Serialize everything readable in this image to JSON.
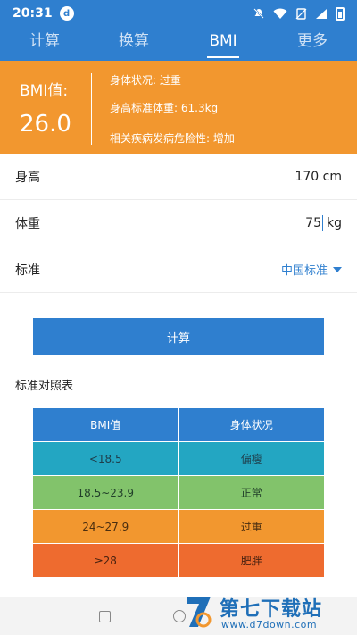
{
  "status_bar": {
    "time": "20:31",
    "app_mark": "d",
    "icons": [
      "mute-icon",
      "wifi-icon",
      "no-sim-icon",
      "signal-icon",
      "battery-icon"
    ]
  },
  "tabs": [
    {
      "label": "计算",
      "active": false
    },
    {
      "label": "换算",
      "active": false
    },
    {
      "label": "BMI",
      "active": true
    },
    {
      "label": "更多",
      "active": false
    }
  ],
  "result": {
    "bmi_label": "BMI值:",
    "bmi_value": "26.0",
    "status": "身体状况: 过重",
    "standard_weight": "身高标准体重: 61.3kg",
    "risk": "相关疾病发病危险性: 增加"
  },
  "inputs": {
    "height_label": "身高",
    "height_value": "170 cm",
    "weight_label": "体重",
    "weight_value": "75",
    "weight_unit": "kg",
    "standard_label": "标准",
    "standard_value": "中国标准"
  },
  "calculate_label": "计算",
  "reference": {
    "title": "标准对照表",
    "headers": [
      "BMI值",
      "身体状况"
    ],
    "rows": [
      [
        "<18.5",
        "偏瘦"
      ],
      [
        "18.5~23.9",
        "正常"
      ],
      [
        "24~27.9",
        "过重"
      ],
      [
        "≥28",
        "肥胖"
      ]
    ]
  },
  "watermark": {
    "brand": "第七下载站",
    "url": "www.d7down.com"
  },
  "colors": {
    "primary": "#2f7fcf",
    "orange": "#f2972f",
    "teal": "#23a6c2",
    "green": "#82c36b",
    "red_orange": "#ee6b2f"
  }
}
